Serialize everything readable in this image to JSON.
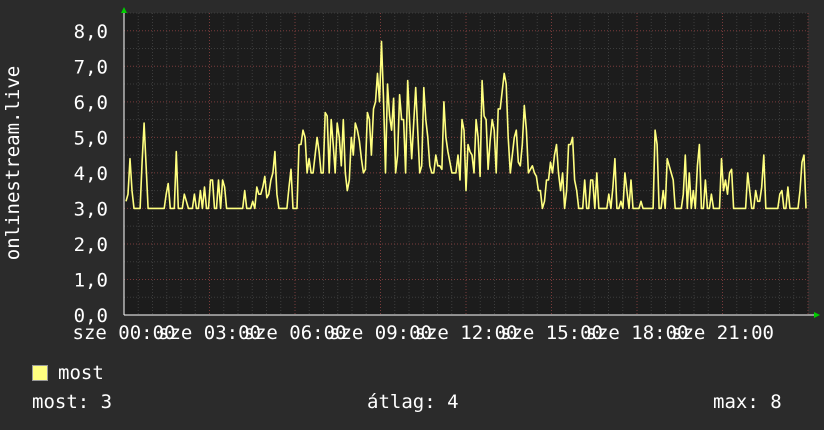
{
  "chart_data": {
    "type": "line",
    "ylabel": "onlinestream.live",
    "ylim": [
      0,
      8.5
    ],
    "yticks": [
      "0,0",
      "1,0",
      "2,0",
      "3,0",
      "4,0",
      "5,0",
      "6,0",
      "7,0",
      "8,0"
    ],
    "xticks": [
      "sze 00:00",
      "sze 03:00",
      "sze 06:00",
      "sze 09:00",
      "sze 12:00",
      "sze 15:00",
      "sze 18:00",
      "sze 21:00"
    ],
    "xrange_hours": [
      0,
      24
    ],
    "grid": true,
    "series": [
      {
        "name": "most",
        "color": "#ffff80",
        "values": [
          3.2,
          3.4,
          4.4,
          3.5,
          3.0,
          3.0,
          3.0,
          3.0,
          4.3,
          5.4,
          4.2,
          3.0,
          3.0,
          3.0,
          3.0,
          3.0,
          3.0,
          3.0,
          3.0,
          3.0,
          3.4,
          3.7,
          3.0,
          3.0,
          3.0,
          4.6,
          3.0,
          3.0,
          3.0,
          3.4,
          3.2,
          3.0,
          3.0,
          3.0,
          3.4,
          3.0,
          3.0,
          3.5,
          3.0,
          3.6,
          3.0,
          3.0,
          3.8,
          3.8,
          3.0,
          3.0,
          3.8,
          3.0,
          3.8,
          3.6,
          3.0,
          3.0,
          3.0,
          3.0,
          3.0,
          3.0,
          3.0,
          3.0,
          3.0,
          3.5,
          3.0,
          3.0,
          3.0,
          3.2,
          3.0,
          3.6,
          3.4,
          3.4,
          3.6,
          3.9,
          3.3,
          3.4,
          3.8,
          4.0,
          4.6,
          3.4,
          3.0,
          3.0,
          3.0,
          3.0,
          3.0,
          3.6,
          4.1,
          3.0,
          3.0,
          3.0,
          4.8,
          4.8,
          5.2,
          5.0,
          4.0,
          4.4,
          4.0,
          4.0,
          4.5,
          5.0,
          4.6,
          4.0,
          4.0,
          5.7,
          5.6,
          4.0,
          5.5,
          4.8,
          4.0,
          5.4,
          5.0,
          4.2,
          5.5,
          4.0,
          3.5,
          3.8,
          5.0,
          4.5,
          5.4,
          5.2,
          4.9,
          4.4,
          4.0,
          4.1,
          5.7,
          5.5,
          4.5,
          5.8,
          6.0,
          6.8,
          6.0,
          7.7,
          6.1,
          4.0,
          6.5,
          5.6,
          5.2,
          6.1,
          4.0,
          4.5,
          6.2,
          5.5,
          5.5,
          4.0,
          6.6,
          5.4,
          4.4,
          5.4,
          6.4,
          5.2,
          4.0,
          4.2,
          6.4,
          5.5,
          5.0,
          4.2,
          4.0,
          4.0,
          4.5,
          4.2,
          4.2,
          4.1,
          6.0,
          5.0,
          4.6,
          4.3,
          4.0,
          4.0,
          4.0,
          4.5,
          3.8,
          5.5,
          5.2,
          3.5,
          4.8,
          4.6,
          4.5,
          4.0,
          5.5,
          5.0,
          3.9,
          6.6,
          5.6,
          5.5,
          4.1,
          4.9,
          5.5,
          5.2,
          4.0,
          5.8,
          5.8,
          6.3,
          6.8,
          6.5,
          5.0,
          4.0,
          4.5,
          5.0,
          5.2,
          4.3,
          4.2,
          4.8,
          5.9,
          5.2,
          4.0,
          4.1,
          4.2,
          4.0,
          3.9,
          3.5,
          3.5,
          3.0,
          3.2,
          3.8,
          3.8,
          4.3,
          4.0,
          4.5,
          4.8,
          4.0,
          3.5,
          4.0,
          3.0,
          3.5,
          4.8,
          4.8,
          5.0,
          3.8,
          3.5,
          3.0,
          3.0,
          3.0,
          3.8,
          3.0,
          3.0,
          3.8,
          3.8,
          3.0,
          4.0,
          3.0,
          3.0,
          3.0,
          3.0,
          3.0,
          3.4,
          3.0,
          3.6,
          4.4,
          3.0,
          3.0,
          3.2,
          3.0,
          4.0,
          3.5,
          3.0,
          3.8,
          3.0,
          3.0,
          3.0,
          3.0,
          3.2,
          3.0,
          3.0,
          3.0,
          3.0,
          3.0,
          3.0,
          5.2,
          4.8,
          3.0,
          3.0,
          3.5,
          3.0,
          4.4,
          4.2,
          4.0,
          3.8,
          3.0,
          3.0,
          3.0,
          3.0,
          3.4,
          4.5,
          3.0,
          4.0,
          3.0,
          3.5,
          3.0,
          4.2,
          4.8,
          3.0,
          3.0,
          3.8,
          3.0,
          3.0,
          3.4,
          3.0,
          3.0,
          3.0,
          3.0,
          4.4,
          3.5,
          3.8,
          3.4,
          4.0,
          4.1,
          3.0,
          3.0,
          3.0,
          3.0,
          3.0,
          3.0,
          3.0,
          4.0,
          3.5,
          3.0,
          3.0,
          3.5,
          3.2,
          3.2,
          3.6,
          4.5,
          3.0,
          3.0,
          3.0,
          3.0,
          3.0,
          3.0,
          3.0,
          3.4,
          3.5,
          3.0,
          3.0,
          3.6,
          3.0,
          3.0,
          3.0,
          3.0,
          3.0,
          3.5,
          4.3,
          4.5,
          3.0
        ]
      }
    ]
  },
  "legend": {
    "label": "most"
  },
  "stats": {
    "most": "most: 3",
    "atlag": "átlag: 4",
    "max": "max: 8"
  }
}
